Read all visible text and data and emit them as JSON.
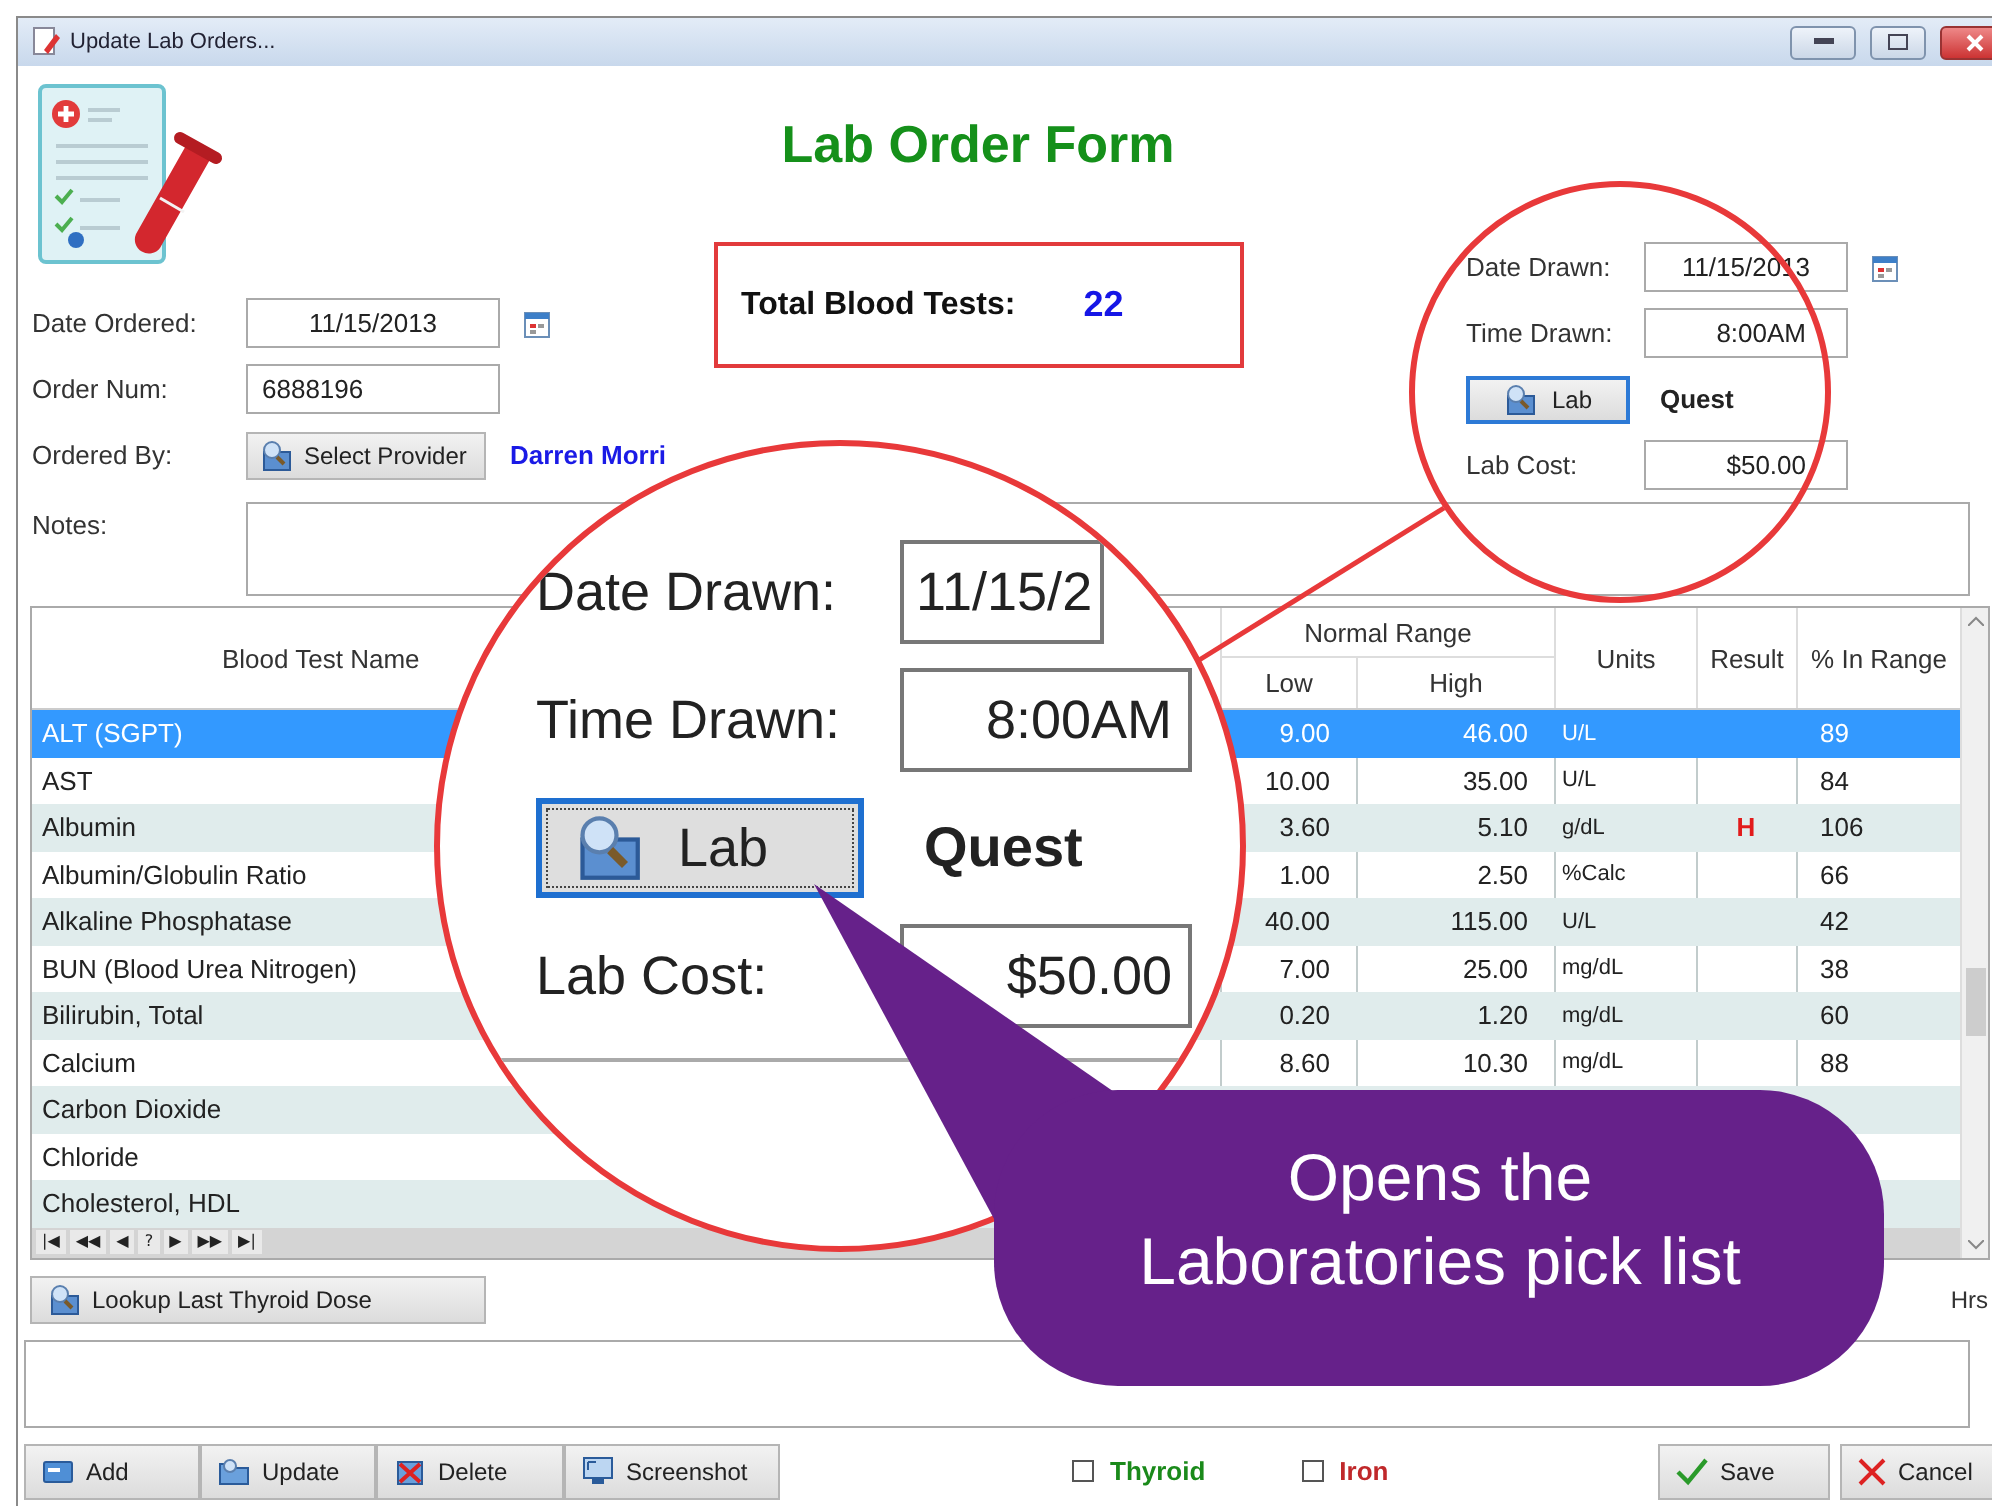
{
  "window": {
    "title": "Update Lab Orders..."
  },
  "form_title": "Lab Order Form",
  "left_fields": [
    {
      "kind": "date",
      "label": "Date Ordered:",
      "value": "11/15/2013"
    },
    {
      "kind": "text",
      "label": "Order Num:",
      "value": "6888196"
    },
    {
      "kind": "picker",
      "label": "Ordered By:",
      "button": "Select Provider",
      "value": "Darren Morri",
      "focused": false
    }
  ],
  "total": {
    "label": "Total Blood Tests:",
    "value": "22"
  },
  "right_fields": [
    {
      "kind": "date",
      "label": "Date Drawn:",
      "value": "11/15/2013"
    },
    {
      "kind": "time",
      "label": "Time Drawn:",
      "value": "8:00AM"
    },
    {
      "kind": "picker",
      "button": "Lab",
      "value": "Quest",
      "focused": true
    },
    {
      "kind": "money",
      "label": "Lab Cost:",
      "value": "$50.00"
    }
  ],
  "notes": {
    "label": "Notes:"
  },
  "table": {
    "name_column": "Blood Test Name",
    "range_group": "Normal Range",
    "columns": [
      "Low",
      "High"
    ],
    "other_columns": [
      "Units",
      "Result",
      "% In Range"
    ],
    "rows": [
      {
        "name": "ALT (SGPT)",
        "low": "9.00",
        "high": "46.00",
        "units": "U/L",
        "pct": "89",
        "selected": true
      },
      {
        "name": "AST",
        "low": "10.00",
        "high": "35.00",
        "units": "U/L",
        "pct": "84",
        "selected": false
      },
      {
        "name": "Albumin",
        "low": "3.60",
        "high": "5.10",
        "units": "g/dL",
        "result": "H",
        "pct": "106",
        "selected": false
      },
      {
        "name": "Albumin/Globulin Ratio",
        "low": "1.00",
        "high": "2.50",
        "units": "%Calc",
        "pct": "66",
        "selected": false
      },
      {
        "name": "Alkaline Phosphatase",
        "low": "40.00",
        "high": "115.00",
        "units": "U/L",
        "pct": "42",
        "selected": false
      },
      {
        "name": "BUN (Blood Urea Nitrogen)",
        "low": "7.00",
        "high": "25.00",
        "units": "mg/dL",
        "pct": "38",
        "selected": false
      },
      {
        "name": "Bilirubin, Total",
        "low": "0.20",
        "high": "1.20",
        "units": "mg/dL",
        "pct": "60",
        "selected": false
      },
      {
        "name": "Calcium",
        "low": "8.60",
        "high": "10.30",
        "units": "mg/dL",
        "pct": "88",
        "selected": false
      },
      {
        "name": "Carbon Dioxide",
        "selected": false
      },
      {
        "name": "Chloride",
        "selected": false
      },
      {
        "name": "Cholesterol, HDL",
        "selected": false
      }
    ]
  },
  "navigator": [
    "|◀",
    "◀◀",
    "◀",
    "?",
    "▶",
    "▶▶",
    "▶|"
  ],
  "lookup_button": "Lookup Last Thyroid Dose",
  "hours_label": "Hrs",
  "actions": [
    {
      "kind": "add",
      "label": "Add"
    },
    {
      "kind": "update",
      "label": "Update"
    },
    {
      "kind": "delete",
      "label": "Delete"
    },
    {
      "kind": "screenshot",
      "label": "Screenshot"
    }
  ],
  "checkboxes": [
    {
      "label": "Thyroid",
      "checked": false,
      "color": "#1a8a1a"
    },
    {
      "label": "Iron",
      "checked": false,
      "color": "#c0282a"
    }
  ],
  "dialog_buttons": [
    {
      "kind": "save",
      "label": "Save"
    },
    {
      "kind": "cancel",
      "label": "Cancel"
    }
  ],
  "magnifier": {
    "fields": [
      {
        "kind": "field",
        "label": "Date Drawn:",
        "value": "11/15/2"
      },
      {
        "kind": "field",
        "label": "Time Drawn:",
        "value": "8:00AM"
      },
      {
        "kind": "picker",
        "button": "Lab",
        "value": "Quest",
        "focused": true
      },
      {
        "kind": "field",
        "label": "Lab Cost:",
        "value": "$50.00"
      }
    ]
  },
  "callout": {
    "text": "Opens the\nLaboratories pick list"
  }
}
